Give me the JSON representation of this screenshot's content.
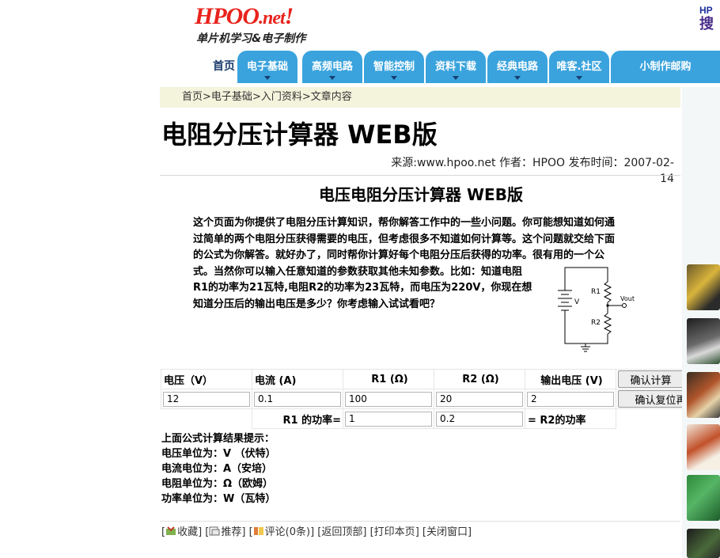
{
  "header": {
    "logo_main": "HPOO",
    "logo_net": ".net",
    "logo_excl": "!",
    "slogan": "单片机学习&电子制作",
    "corner_hp": "HP",
    "corner_sou": "搜"
  },
  "nav": {
    "home": "首页",
    "tabs": [
      "电子基础",
      "高频电路",
      "智能控制",
      "资料下载",
      "经典电路",
      "唯客.社区",
      "小制作邮购"
    ]
  },
  "breadcrumb": {
    "home": "首页",
    "sep": ">",
    "level1": "电子基础",
    "level2": "入门资料",
    "current": "文章内容"
  },
  "article": {
    "title": "电阻分压计算器 WEB版",
    "meta": "来源:www.hpoo.net 作者：HPOO 发布时间：2007-02-14",
    "subtitle": "电压电阻分压计算器 WEB版",
    "intro_lines": [
      "这个页面为你提供了电阻分压计算知识，帮你解答工作中的一些小问题。你可能想知道如何通",
      "过简单的两个电阻分压获得需要的电压，但考虑很多不知道如何计算等。这个问题就交给下面",
      "的公式为你解答。就好办了，同时帮你计算好每个电阻分压后获得的功率。很有用的一个公",
      "式。当然你可以输入任意知道的参数获取其他未知参数。比如：知道电阻",
      "R1的功率为21瓦特,电阻R2的功率为23瓦特，而电压为220V，你现在想",
      "知道分压后的输出电压是多少？你考虑输入试试看吧？"
    ]
  },
  "circuit": {
    "label_v": "V",
    "label_r1": "R1",
    "label_r2": "R2",
    "label_vout": "Vout"
  },
  "calculator": {
    "headers": {
      "voltage": "电压（V）",
      "current": "电流 (A)",
      "r1": "R1 (Ω)",
      "r2": "R2 (Ω)",
      "vout": "输出电压 (V)"
    },
    "values": {
      "voltage": "12",
      "current": "0.1",
      "r1": "100",
      "r2": "20",
      "vout": "2"
    },
    "power_row": {
      "r1_label": "R1 的功率=",
      "r1_value": "1",
      "r2_value": "0.2",
      "r2_label": "= R2的功率"
    },
    "buttons": {
      "compute": "确认计算",
      "reset": "确认复位再来"
    }
  },
  "units": {
    "heading": "上面公式计算结果提示：",
    "lines": [
      "电压单位为：V （伏特）",
      "电流电位为：A（安培）",
      "电阻单位为：Ω（欧姆）",
      "功率单位为：W（瓦特）"
    ]
  },
  "footer": {
    "collect": "收藏",
    "recommend": "推荐",
    "comment": "评论(0条)",
    "back_top": "返回顶部",
    "print": "打印本页",
    "close": "关闭窗口"
  },
  "colors": {
    "nav_tab": "#3aa3dd",
    "logo": "#e8231c",
    "breadcrumb_bg": "#f4f4dd"
  }
}
